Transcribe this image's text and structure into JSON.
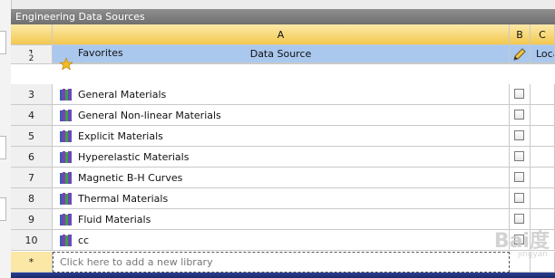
{
  "panel": {
    "title": "Engineering Data Sources"
  },
  "columns": {
    "a": "A",
    "b": "B",
    "c": "C"
  },
  "subheader": {
    "row_num": "1",
    "data_source": "Data Source",
    "location": "Loca"
  },
  "rows": [
    {
      "num": "2",
      "label": "Favorites",
      "icon": "star-icon"
    },
    {
      "num": "3",
      "label": "General Materials",
      "icon": "book-library-icon"
    },
    {
      "num": "4",
      "label": "General Non-linear Materials",
      "icon": "book-library-icon"
    },
    {
      "num": "5",
      "label": "Explicit Materials",
      "icon": "book-library-icon"
    },
    {
      "num": "6",
      "label": "Hyperelastic Materials",
      "icon": "book-library-icon"
    },
    {
      "num": "7",
      "label": "Magnetic B-H Curves",
      "icon": "book-library-icon"
    },
    {
      "num": "8",
      "label": "Thermal Materials",
      "icon": "book-library-icon"
    },
    {
      "num": "9",
      "label": "Fluid Materials",
      "icon": "book-library-icon"
    },
    {
      "num": "10",
      "label": "cc",
      "icon": "book-library-icon"
    }
  ],
  "new_row": {
    "marker": "*",
    "placeholder": "Click here to add a new library"
  },
  "watermark": {
    "text": "Bai度",
    "sub": "jingyan"
  },
  "colors": {
    "header": "#f2c94f",
    "subheader": "#aac8ee",
    "bottom_bar": "#1b2a6a"
  }
}
